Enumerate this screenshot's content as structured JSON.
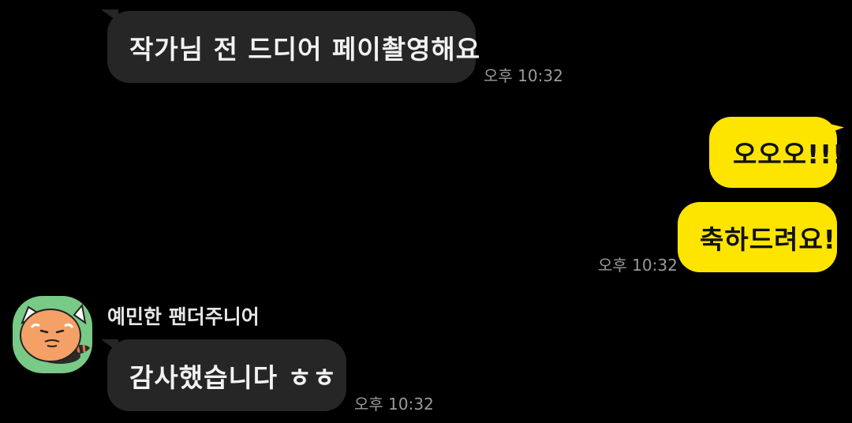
{
  "colors": {
    "background": "#000000",
    "incoming_bubble": "#262626",
    "outgoing_bubble": "#fee500",
    "timestamp": "#9a9a9a",
    "avatar_background": "#79c987"
  },
  "messages": [
    {
      "direction": "incoming",
      "text": "작가님 전 드디어 페이촬영해요",
      "time": "오후 10:32"
    },
    {
      "direction": "outgoing",
      "text": "오오오!!!",
      "time": ""
    },
    {
      "direction": "outgoing",
      "text": "축하드려요!",
      "time": "오후 10:32"
    },
    {
      "direction": "incoming",
      "sender": "예민한 팬더주니어",
      "avatar_icon": "red-panda-avatar-icon",
      "text": "감사했습니다 ㅎㅎ",
      "time": "오후 10:32"
    }
  ]
}
